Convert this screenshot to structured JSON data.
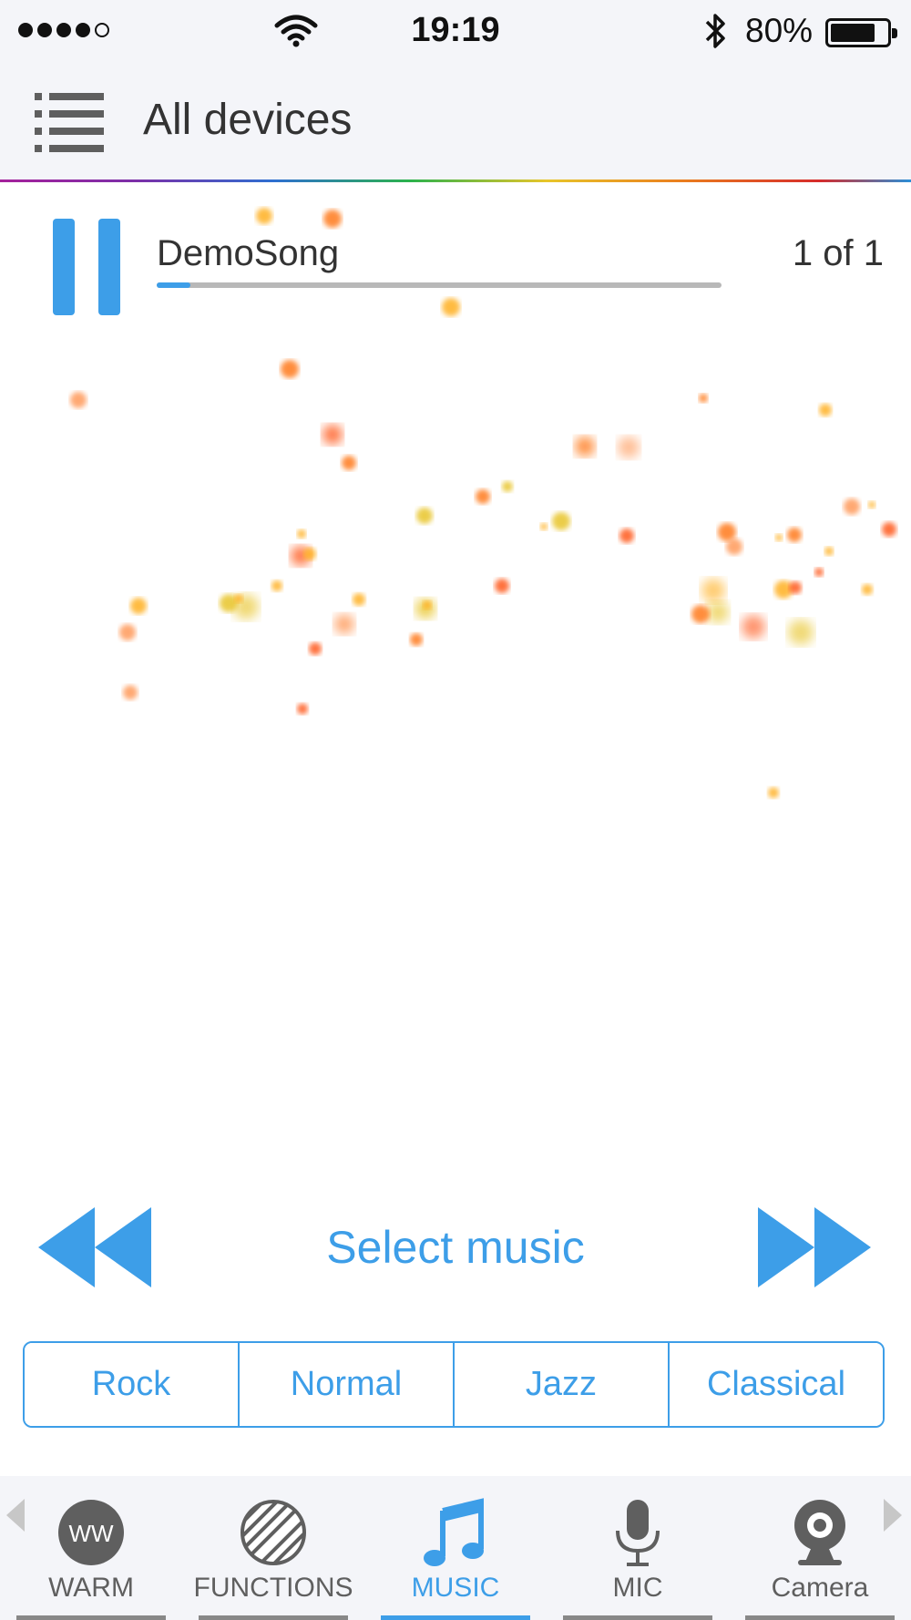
{
  "status_bar": {
    "time": "19:19",
    "battery_percent": "80%",
    "battery_level": 0.8,
    "signal_bars": 4,
    "signal_total": 5,
    "icons": [
      "wifi-icon",
      "bluetooth-icon",
      "battery-icon"
    ]
  },
  "header": {
    "title": "All devices",
    "menu_icon": "list-menu-icon"
  },
  "player": {
    "song_title": "DemoSong",
    "track_count": "1 of 1",
    "progress": 0.06,
    "state": "playing",
    "pause_icon": "pause-icon"
  },
  "controls": {
    "select_music_label": "Select music",
    "previous_icon": "rewind-icon",
    "next_icon": "fast-forward-icon"
  },
  "equalizer": {
    "options": [
      "Rock",
      "Normal",
      "Jazz",
      "Classical"
    ],
    "selected": "Classical"
  },
  "tabs": [
    {
      "label": "WARM",
      "icon": "warm-ww-icon",
      "badge_text": "WW",
      "active": false
    },
    {
      "label": "FUNCTIONS",
      "icon": "striped-circle-icon",
      "active": false
    },
    {
      "label": "MUSIC",
      "icon": "music-note-icon",
      "active": true
    },
    {
      "label": "MIC",
      "icon": "microphone-icon",
      "active": false
    },
    {
      "label": "Camera",
      "icon": "camera-icon",
      "active": false
    }
  ],
  "colors": {
    "accent": "#3d9ee8",
    "icon_gray": "#5f5f5f",
    "bar_background": "#f4f5f9",
    "particle_palette": [
      "#ff7a1a",
      "#ffb020",
      "#ff5a1f",
      "#e8c52a",
      "#ff9a5a"
    ]
  }
}
